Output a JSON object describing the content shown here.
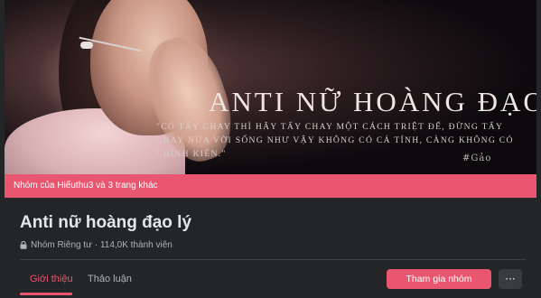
{
  "cover": {
    "title": "ANTI NỮ HOÀNG ĐẠO LÝ",
    "quote": "\"CÓ TẨY CHAY THÌ HÃY TẨY CHAY MỘT CÁCH TRIỆT ĐỂ, ĐỪNG TẨY CHAY NỬA VỜI SỐNG NHƯ VẬY KHÔNG CÓ CÁ TÍNH, CÀNG KHÔNG CÓ CHÍNH KIẾN.\"",
    "signature": "#Gảo"
  },
  "banner": {
    "text": "Nhóm của Hiếuthu3 và 3 trang khác"
  },
  "group": {
    "name": "Anti nữ hoàng đạo lý",
    "privacy": "Nhóm Riêng tư",
    "members": "· 114,0K thành viên"
  },
  "tabs": [
    {
      "label": "Giới thiệu",
      "active": true
    },
    {
      "label": "Thảo luận",
      "active": false
    }
  ],
  "actions": {
    "join_label": "Tham gia nhóm",
    "more_label": "···"
  },
  "colors": {
    "accent": "#e8566f",
    "background": "#242526"
  },
  "icons": {
    "lock": "lock-icon",
    "more": "more-icon"
  }
}
